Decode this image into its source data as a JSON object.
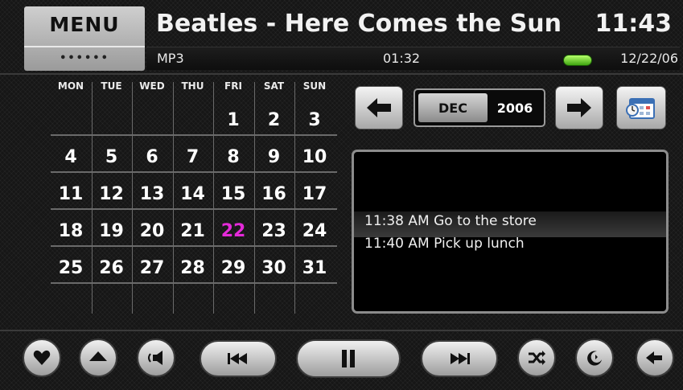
{
  "header": {
    "menu_label": "MENU",
    "menu_dots": "••••••",
    "song_title": "Beatles - Here Comes the Sun",
    "clock": "11:43",
    "format": "MP3",
    "elapsed": "01:32",
    "date": "12/22/06",
    "battery_color": "#5fd61c"
  },
  "calendar": {
    "weekdays": [
      "MON",
      "TUE",
      "WED",
      "THU",
      "FRI",
      "SAT",
      "SUN"
    ],
    "weeks": [
      [
        "",
        "",
        "",
        "",
        "1",
        "2",
        "3"
      ],
      [
        "4",
        "5",
        "6",
        "7",
        "8",
        "9",
        "10"
      ],
      [
        "11",
        "12",
        "13",
        "14",
        "15",
        "16",
        "17"
      ],
      [
        "18",
        "19",
        "20",
        "21",
        "22",
        "23",
        "24"
      ],
      [
        "25",
        "26",
        "27",
        "28",
        "29",
        "30",
        "31"
      ],
      [
        "",
        "",
        "",
        "",
        "",
        "",
        ""
      ]
    ],
    "today": "22",
    "today_color": "#e42ad9",
    "month": "DEC",
    "year": "2006"
  },
  "events": [
    {
      "text": "11:38 AM Go to the store"
    },
    {
      "text": "11:40 AM Pick up lunch"
    }
  ],
  "controls": {
    "icons": [
      "heart-icon",
      "eject-up-icon",
      "speaker-icon",
      "previous-track-icon",
      "pause-icon",
      "next-track-icon",
      "shuffle-icon",
      "repeat-moon-icon",
      "back-arrow-icon"
    ]
  }
}
